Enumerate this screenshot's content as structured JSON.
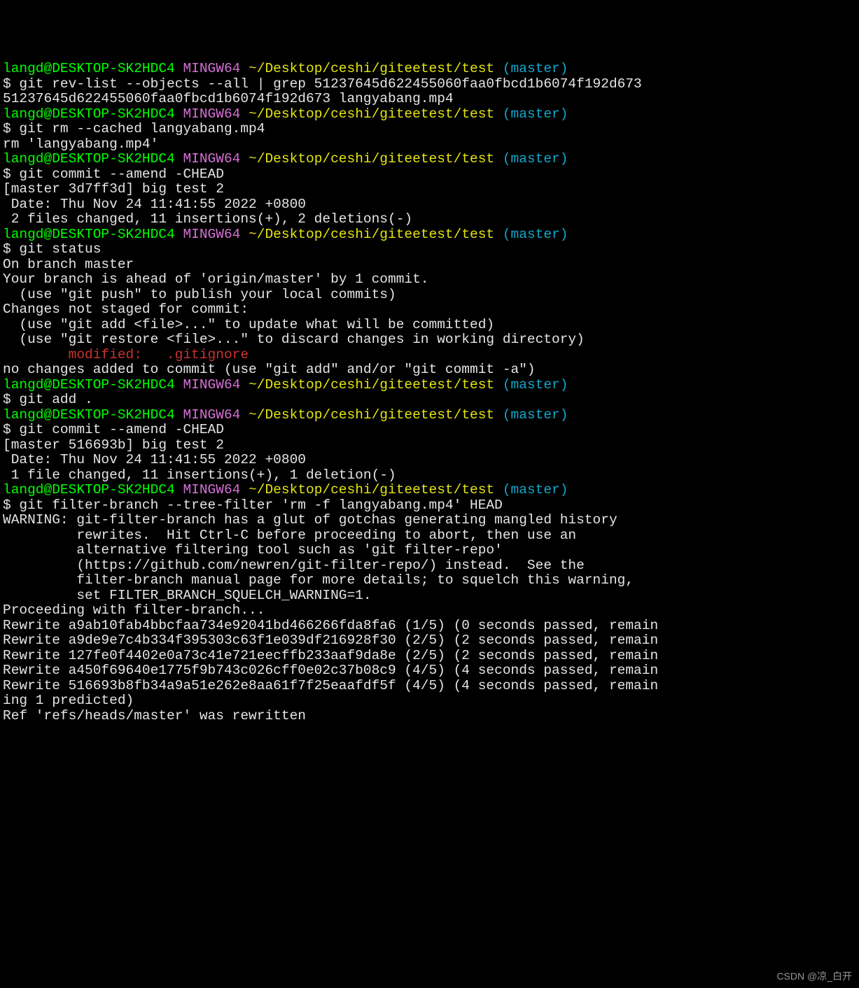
{
  "prompt": {
    "user_host": "langd@DESKTOP-SK2HDC4",
    "env": " MINGW64 ",
    "path": "~/Desktop/ceshi/giteetest/test",
    "branch_open": " (",
    "branch": "master",
    "branch_close": ")",
    "ps1": "$ "
  },
  "blocks": [
    {
      "cmd": "git rev-list --objects --all | grep 51237645d622455060faa0fbcd1b6074f192d673",
      "out": [
        "51237645d622455060faa0fbcd1b6074f192d673 langyabang.mp4"
      ]
    },
    {
      "cmd": "git rm --cached langyabang.mp4",
      "out": [
        "rm 'langyabang.mp4'"
      ]
    },
    {
      "cmd": "git commit --amend -CHEAD",
      "out": [
        "[master 3d7ff3d] big test 2",
        " Date: Thu Nov 24 11:41:55 2022 +0800",
        " 2 files changed, 11 insertions(+), 2 deletions(-)"
      ]
    },
    {
      "cmd": "git status",
      "out": [
        "On branch master",
        "Your branch is ahead of 'origin/master' by 1 commit.",
        "  (use \"git push\" to publish your local commits)",
        "",
        "Changes not staged for commit:",
        "  (use \"git add <file>...\" to update what will be committed)",
        "  (use \"git restore <file>...\" to discard changes in working directory)"
      ],
      "modified": "        modified:   .gitignore",
      "out2": [
        "",
        "no changes added to commit (use \"git add\" and/or \"git commit -a\")"
      ]
    },
    {
      "cmd": "git add .",
      "out": []
    },
    {
      "cmd": "git commit --amend -CHEAD",
      "out": [
        "[master 516693b] big test 2",
        " Date: Thu Nov 24 11:41:55 2022 +0800",
        " 1 file changed, 11 insertions(+), 1 deletion(-)"
      ]
    },
    {
      "cmd": "git filter-branch --tree-filter 'rm -f langyabang.mp4' HEAD",
      "out": [
        "WARNING: git-filter-branch has a glut of gotchas generating mangled history",
        "         rewrites.  Hit Ctrl-C before proceeding to abort, then use an",
        "         alternative filtering tool such as 'git filter-repo'",
        "         (https://github.com/newren/git-filter-repo/) instead.  See the",
        "         filter-branch manual page for more details; to squelch this warning,",
        "         set FILTER_BRANCH_SQUELCH_WARNING=1.",
        "Proceeding with filter-branch...",
        "",
        "Rewrite a9ab10fab4bbcfaa734e92041bd466266fda8fa6 (1/5) (0 seconds passed, remain",
        "Rewrite a9de9e7c4b334f395303c63f1e039df216928f30 (2/5) (2 seconds passed, remain",
        "Rewrite 127fe0f4402e0a73c41e721eecffb233aaf9da8e (2/5) (2 seconds passed, remain",
        "Rewrite a450f69640e1775f9b743c026cff0e02c37b08c9 (4/5) (4 seconds passed, remain",
        "Rewrite 516693b8fb34a9a51e262e8aa61f7f25eaafdf5f (4/5) (4 seconds passed, remain",
        "ing 1 predicted)",
        "Ref 'refs/heads/master' was rewritten"
      ]
    }
  ],
  "watermark": "CSDN @凉_白开"
}
